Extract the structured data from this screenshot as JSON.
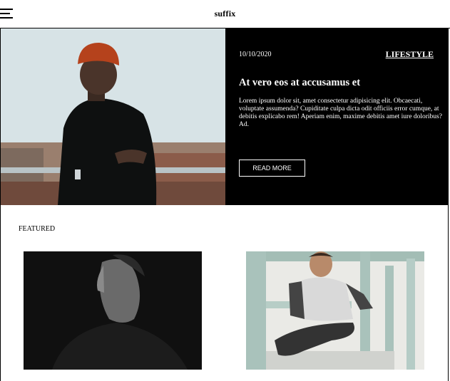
{
  "header": {
    "brand": "suffix"
  },
  "hero": {
    "date": "10/10/2020",
    "category": "LIFESTYLE",
    "title": "At vero eos at accusamus et",
    "excerpt": "Lorem ipsum dolor sit, amet consectetur adipisicing elit. Obcaecati, voluptate assumenda? Cupiditate culpa dicta odit officiis error cumque, at debitis explicabo rem! Aperiam enim, maxime debitis amet iure doloribus? Ad.",
    "button": "READ MORE"
  },
  "featured": {
    "label": "FEATURED"
  },
  "colors": {
    "panel": "#000000",
    "text_on_panel": "#ffffff"
  },
  "icons": {
    "menu": "hamburger-icon"
  }
}
